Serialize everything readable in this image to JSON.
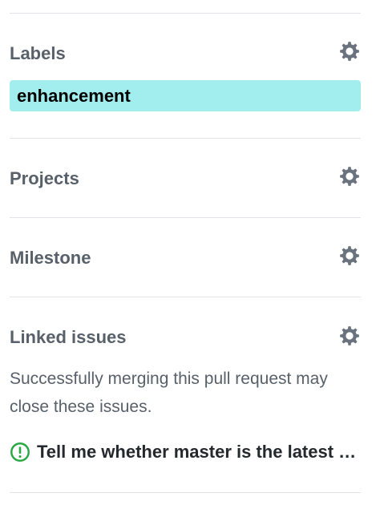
{
  "colors": {
    "heading": "#586069",
    "gear_icon": "#6a737d",
    "divider": "#e1e4e8",
    "label_bg": "#a2eeef",
    "label_text": "#000000",
    "issue_open_icon": "#28a745"
  },
  "labels": {
    "heading": "Labels",
    "icon": "gear-icon",
    "items": [
      {
        "name": "enhancement"
      }
    ]
  },
  "projects": {
    "heading": "Projects",
    "icon": "gear-icon"
  },
  "milestone": {
    "heading": "Milestone",
    "icon": "gear-icon"
  },
  "linked_issues": {
    "heading": "Linked issues",
    "icon": "gear-icon",
    "description": "Successfully merging this pull request may close these issues.",
    "items": [
      {
        "icon": "issue-opened-icon",
        "title": "Tell me whether master is the latest version"
      }
    ]
  }
}
